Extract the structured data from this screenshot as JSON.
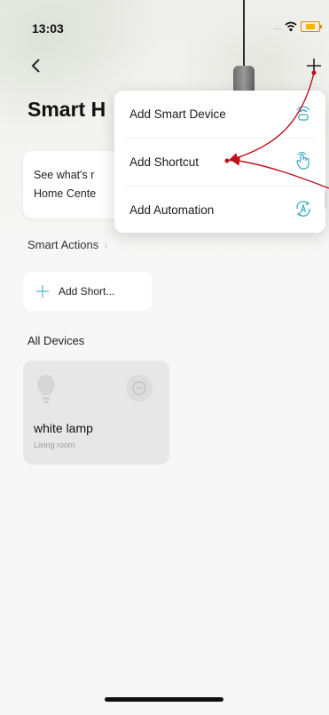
{
  "status_bar": {
    "time": "13:03",
    "signal": "....."
  },
  "header": {
    "title": "Smart H"
  },
  "promo": {
    "line1": "See what's r",
    "line2": "Home Cente"
  },
  "sections": {
    "smart_actions": "Smart Actions",
    "all_devices": "All Devices"
  },
  "add_shortcut_pill": {
    "label": "Add Short..."
  },
  "device": {
    "name": "white lamp",
    "room": "Living room"
  },
  "dropdown": {
    "items": [
      {
        "label": "Add Smart Device",
        "icon": "smart-device-icon"
      },
      {
        "label": "Add Shortcut",
        "icon": "tap-hand-icon"
      },
      {
        "label": "Add Automation",
        "icon": "automation-icon"
      }
    ]
  },
  "colors": {
    "accent": "#39a9c4",
    "annotation": "#c0101a",
    "battery": "#f5b800"
  }
}
